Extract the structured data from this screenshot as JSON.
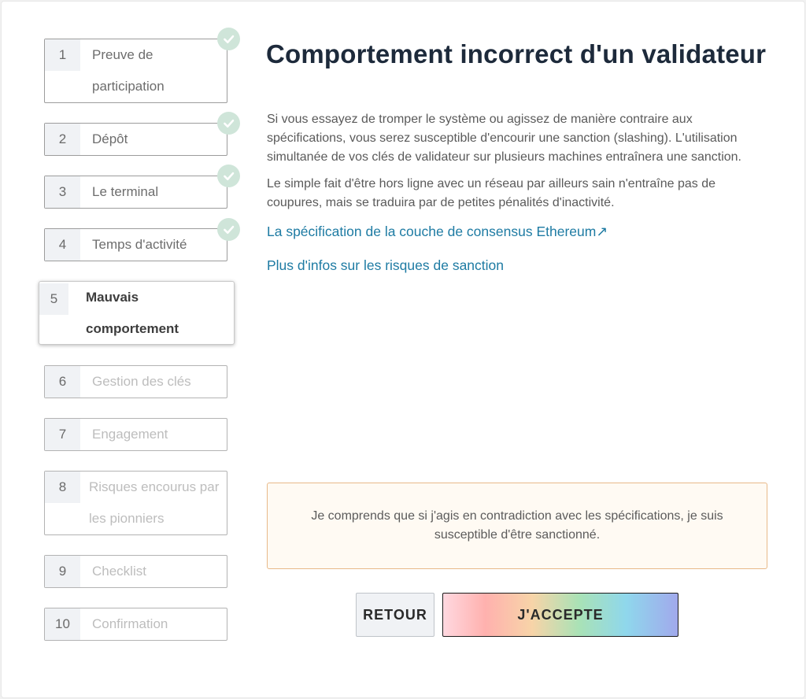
{
  "steps": [
    {
      "number": "1",
      "label": "Preuve de participation",
      "status": "completed"
    },
    {
      "number": "2",
      "label": "Dépôt",
      "status": "completed"
    },
    {
      "number": "3",
      "label": "Le terminal",
      "status": "completed"
    },
    {
      "number": "4",
      "label": "Temps d'activité",
      "status": "completed"
    },
    {
      "number": "5",
      "label": "Mauvais comportement",
      "status": "active"
    },
    {
      "number": "6",
      "label": "Gestion des clés",
      "status": "pending"
    },
    {
      "number": "7",
      "label": "Engagement",
      "status": "pending"
    },
    {
      "number": "8",
      "label": "Risques encourus par les pionniers",
      "status": "pending"
    },
    {
      "number": "9",
      "label": "Checklist",
      "status": "pending"
    },
    {
      "number": "10",
      "label": "Confirmation",
      "status": "pending"
    }
  ],
  "main": {
    "title": "Comportement incorrect d'un validateur",
    "paragraph1": "Si vous essayez de tromper le système ou agissez de manière contraire aux spécifications, vous serez susceptible d'encourir une sanction (slashing). L'utilisation simultanée de vos clés de validateur sur plusieurs machines entraînera une sanction.",
    "paragraph2": "Le simple fait d'être hors ligne avec un réseau par ailleurs sain n'entraîne pas de coupures, mais se traduira par de petites pénalités d'inactivité.",
    "link_spec": "La spécification de la couche de consensus Ethereum↗",
    "link_risks": "Plus d'infos sur les risques de sanction",
    "acknowledgement": "Je comprends que si j'agis en contradiction avec les spécifications, je suis susceptible d'être sanctionné."
  },
  "buttons": {
    "back": "RETOUR",
    "accept": "J'ACCEPTE"
  },
  "colors": {
    "check_bg": "#cfe5d9",
    "link": "#1e7ba3",
    "title": "#1d2a3b",
    "ack_border": "#e8b989"
  },
  "icons": {
    "completed": "checkmark-icon"
  }
}
